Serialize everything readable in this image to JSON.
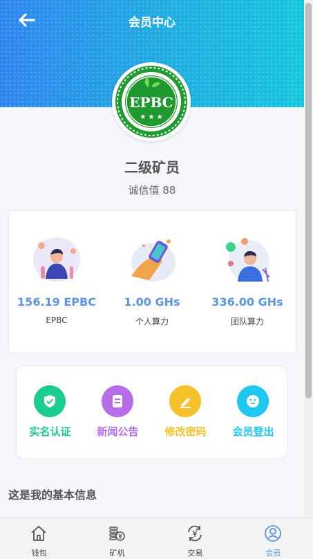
{
  "header": {
    "title": "会员中心",
    "back_icon": "arrow-left-icon"
  },
  "logo": {
    "text": "EPBC"
  },
  "profile": {
    "level": "二级矿员",
    "credit": "诚信值 88"
  },
  "stats": [
    {
      "value": "156.19 EPBC",
      "label": "EPBC"
    },
    {
      "value": "1.00 GHs",
      "label": "个人算力"
    },
    {
      "value": "336.00 GHs",
      "label": "团队算力"
    }
  ],
  "actions": [
    {
      "label": "实名认证",
      "color": "#1ccb8e",
      "icon": "shield-check-icon"
    },
    {
      "label": "新闻公告",
      "color": "#b66ee8",
      "icon": "document-icon"
    },
    {
      "label": "修改密码",
      "color": "#f5c22b",
      "icon": "edit-icon"
    },
    {
      "label": "会员登出",
      "color": "#1ec7f0",
      "icon": "face-icon"
    }
  ],
  "section": {
    "title": "这是我的基本信息"
  },
  "tabbar": {
    "items": [
      {
        "label": "钱包",
        "icon": "home-icon"
      },
      {
        "label": "矿机",
        "icon": "coins-icon"
      },
      {
        "label": "交易",
        "icon": "exchange-icon"
      },
      {
        "label": "会员",
        "icon": "user-icon"
      }
    ],
    "active_color": "#5b95e0"
  }
}
